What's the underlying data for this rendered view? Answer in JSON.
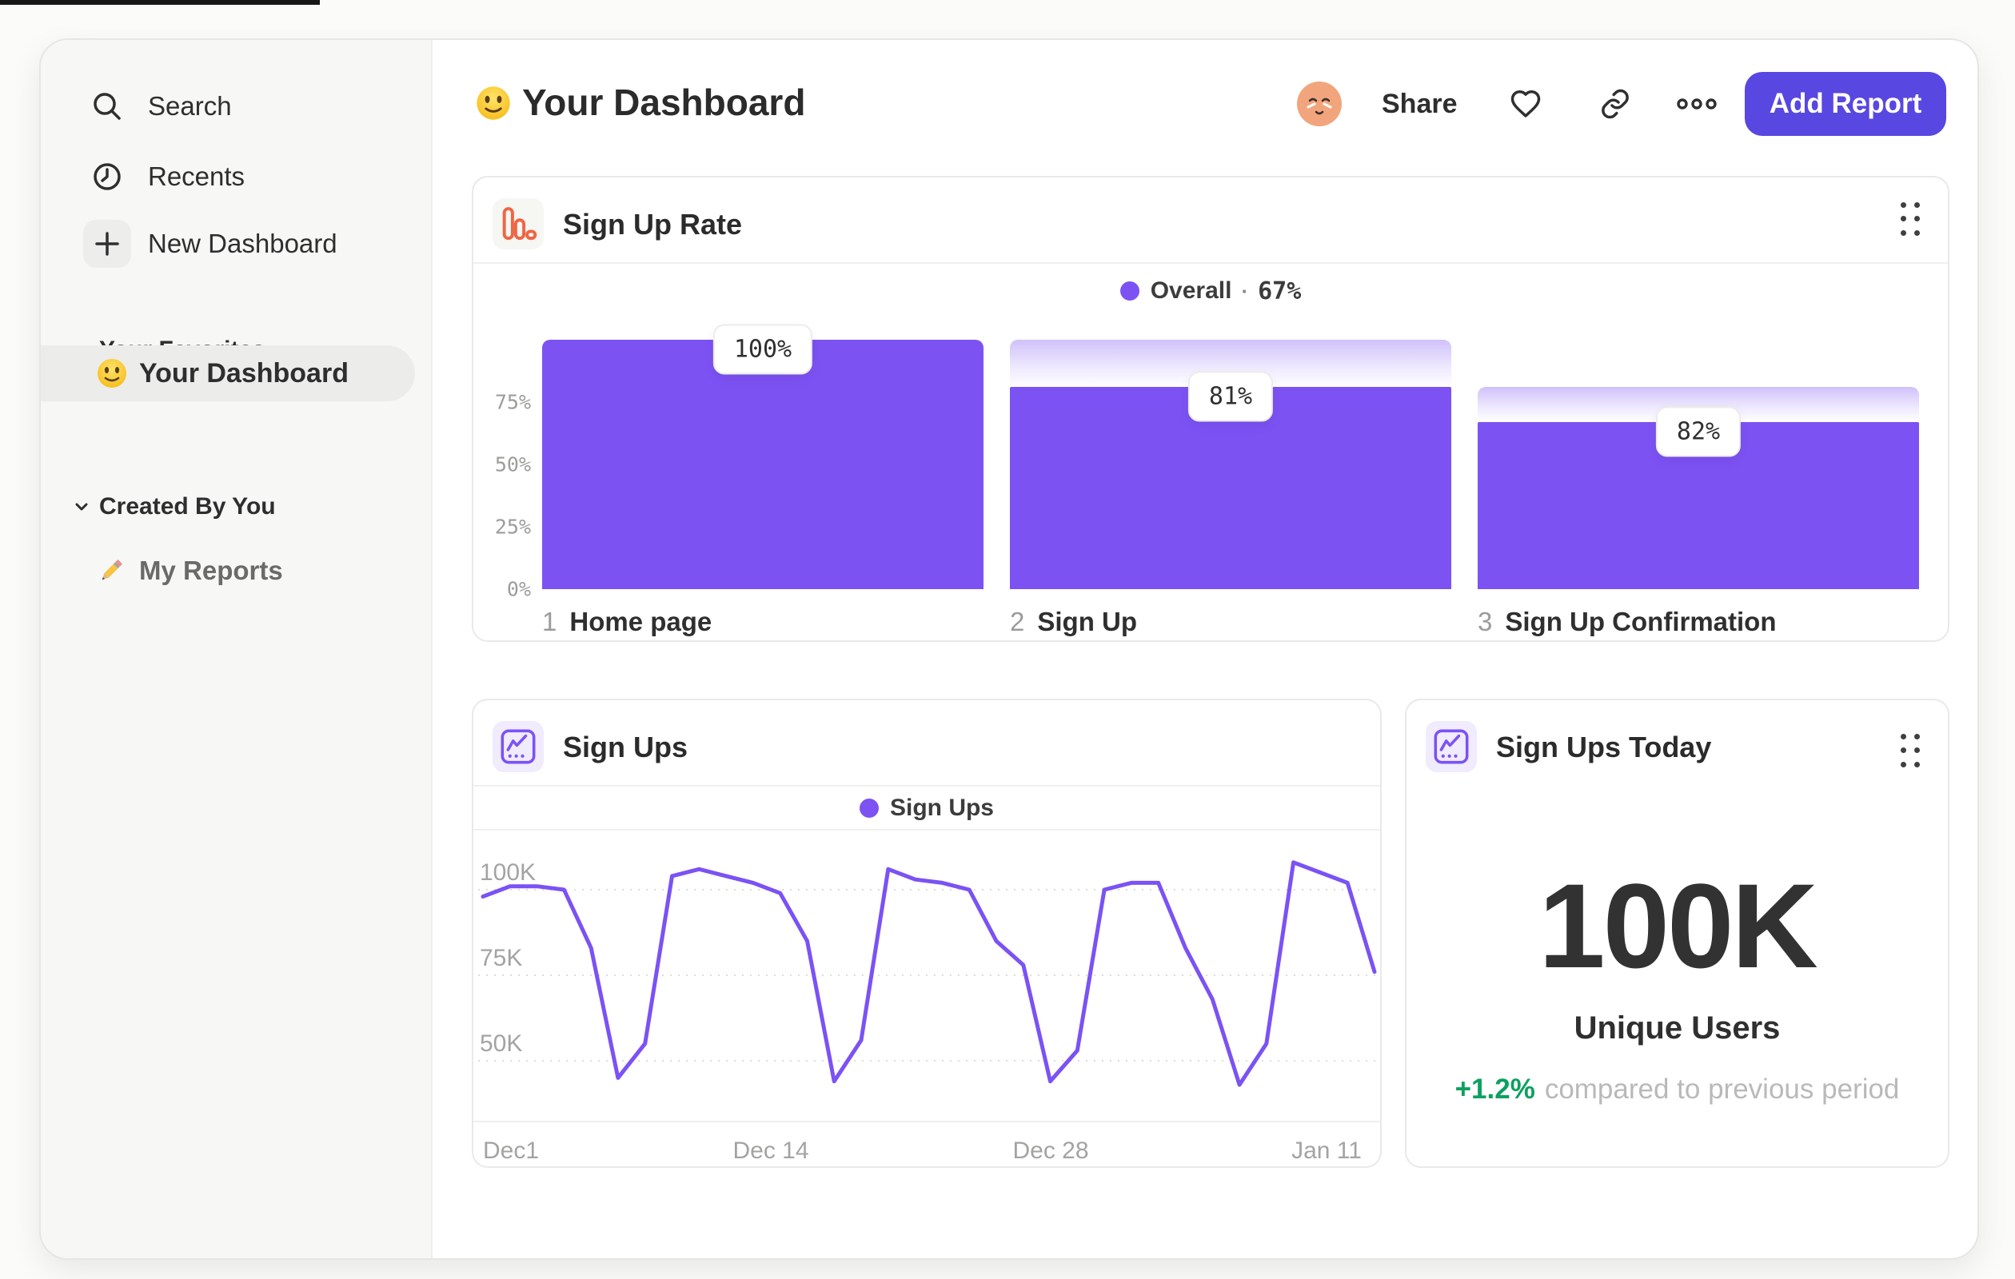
{
  "sidebar": {
    "top_items": [
      {
        "icon": "search-icon",
        "label": "Search"
      },
      {
        "icon": "clock-icon",
        "label": "Recents"
      },
      {
        "icon": "plus-icon",
        "label": "New Dashboard"
      }
    ],
    "sections": [
      {
        "title": "Your Favorites",
        "items": [
          {
            "icon": "smiley-emoji-icon",
            "label": "Your Dashboard",
            "selected": true
          }
        ]
      },
      {
        "title": "Created By You",
        "items": [
          {
            "icon": "pencil-emoji-icon",
            "label": "My Reports",
            "selected": false
          }
        ]
      }
    ]
  },
  "header": {
    "title_icon": "smiley-emoji-icon",
    "title": "Your Dashboard",
    "share_label": "Share",
    "add_report_label": "Add Report"
  },
  "cards": {
    "signup_rate": {
      "title": "Sign Up Rate",
      "icon": "funnel-chart-icon",
      "legend": {
        "label": "Overall",
        "separator": "·",
        "value": "67%"
      },
      "y_ticks": [
        "75%",
        "50%",
        "25%",
        "0%"
      ],
      "steps": [
        {
          "index": "1",
          "name": "Home page",
          "label": "100%",
          "overall_pct": 100
        },
        {
          "index": "2",
          "name": "Sign Up",
          "label": "81%",
          "overall_pct": 81
        },
        {
          "index": "3",
          "name": "Sign Up Confirmation",
          "label": "82%",
          "overall_pct": 67
        }
      ]
    },
    "sign_ups": {
      "title": "Sign Ups",
      "icon": "line-chart-icon",
      "legend": {
        "label": "Sign Ups"
      },
      "y_ticks": [
        "100K",
        "75K",
        "50K"
      ],
      "x_ticks": [
        "Dec1",
        "Dec 14",
        "Dec 28",
        "Jan 11"
      ]
    },
    "sign_ups_today": {
      "title": "Sign Ups Today",
      "icon": "line-chart-icon",
      "value": "100K",
      "value_label": "Unique Users",
      "delta": "+1.2%",
      "delta_note": "compared to previous period"
    }
  },
  "colors": {
    "purple": "#7C52F3",
    "indigo_button": "#5847E1",
    "orange_icon": "#EE6644",
    "green_delta": "#0CA05F",
    "sidebar_bg": "#F7F7F5",
    "gray_text": "#9C9C9A"
  },
  "chart_data": [
    {
      "type": "bar",
      "subtype": "funnel",
      "title": "Sign Up Rate",
      "legend": [
        "Overall · 67%"
      ],
      "legend_position": "top-center",
      "categories": [
        "1 Home page",
        "2 Sign Up",
        "3 Sign Up Confirmation"
      ],
      "series": [
        {
          "name": "overall_conversion_pct",
          "values": [
            100,
            81,
            67
          ]
        },
        {
          "name": "step_conversion_labels",
          "values": [
            "100%",
            "81%",
            "82%"
          ]
        }
      ],
      "ylim": [
        0,
        100
      ],
      "yticks": [
        0,
        25,
        50,
        75
      ],
      "grid": false,
      "bar_color": "#7C52F3"
    },
    {
      "type": "line",
      "title": "Sign Ups",
      "legend": [
        "Sign Ups"
      ],
      "legend_position": "top-center",
      "xlabel": "",
      "ylabel": "",
      "x_ticks": [
        "Dec1",
        "Dec 14",
        "Dec 28",
        "Jan 11"
      ],
      "unit": "K users per day",
      "values": [
        98,
        101,
        101,
        100,
        83,
        45,
        55,
        104,
        106,
        104,
        102,
        99,
        85,
        44,
        56,
        106,
        103,
        102,
        100,
        85,
        78,
        44,
        53,
        100,
        102,
        102,
        83,
        68,
        43,
        55,
        108,
        105,
        102,
        76
      ],
      "ylim": [
        40,
        112
      ],
      "yticks": [
        50,
        75,
        100
      ],
      "grid": "dashed-horizontal",
      "line_color": "#7B52F4"
    }
  ]
}
